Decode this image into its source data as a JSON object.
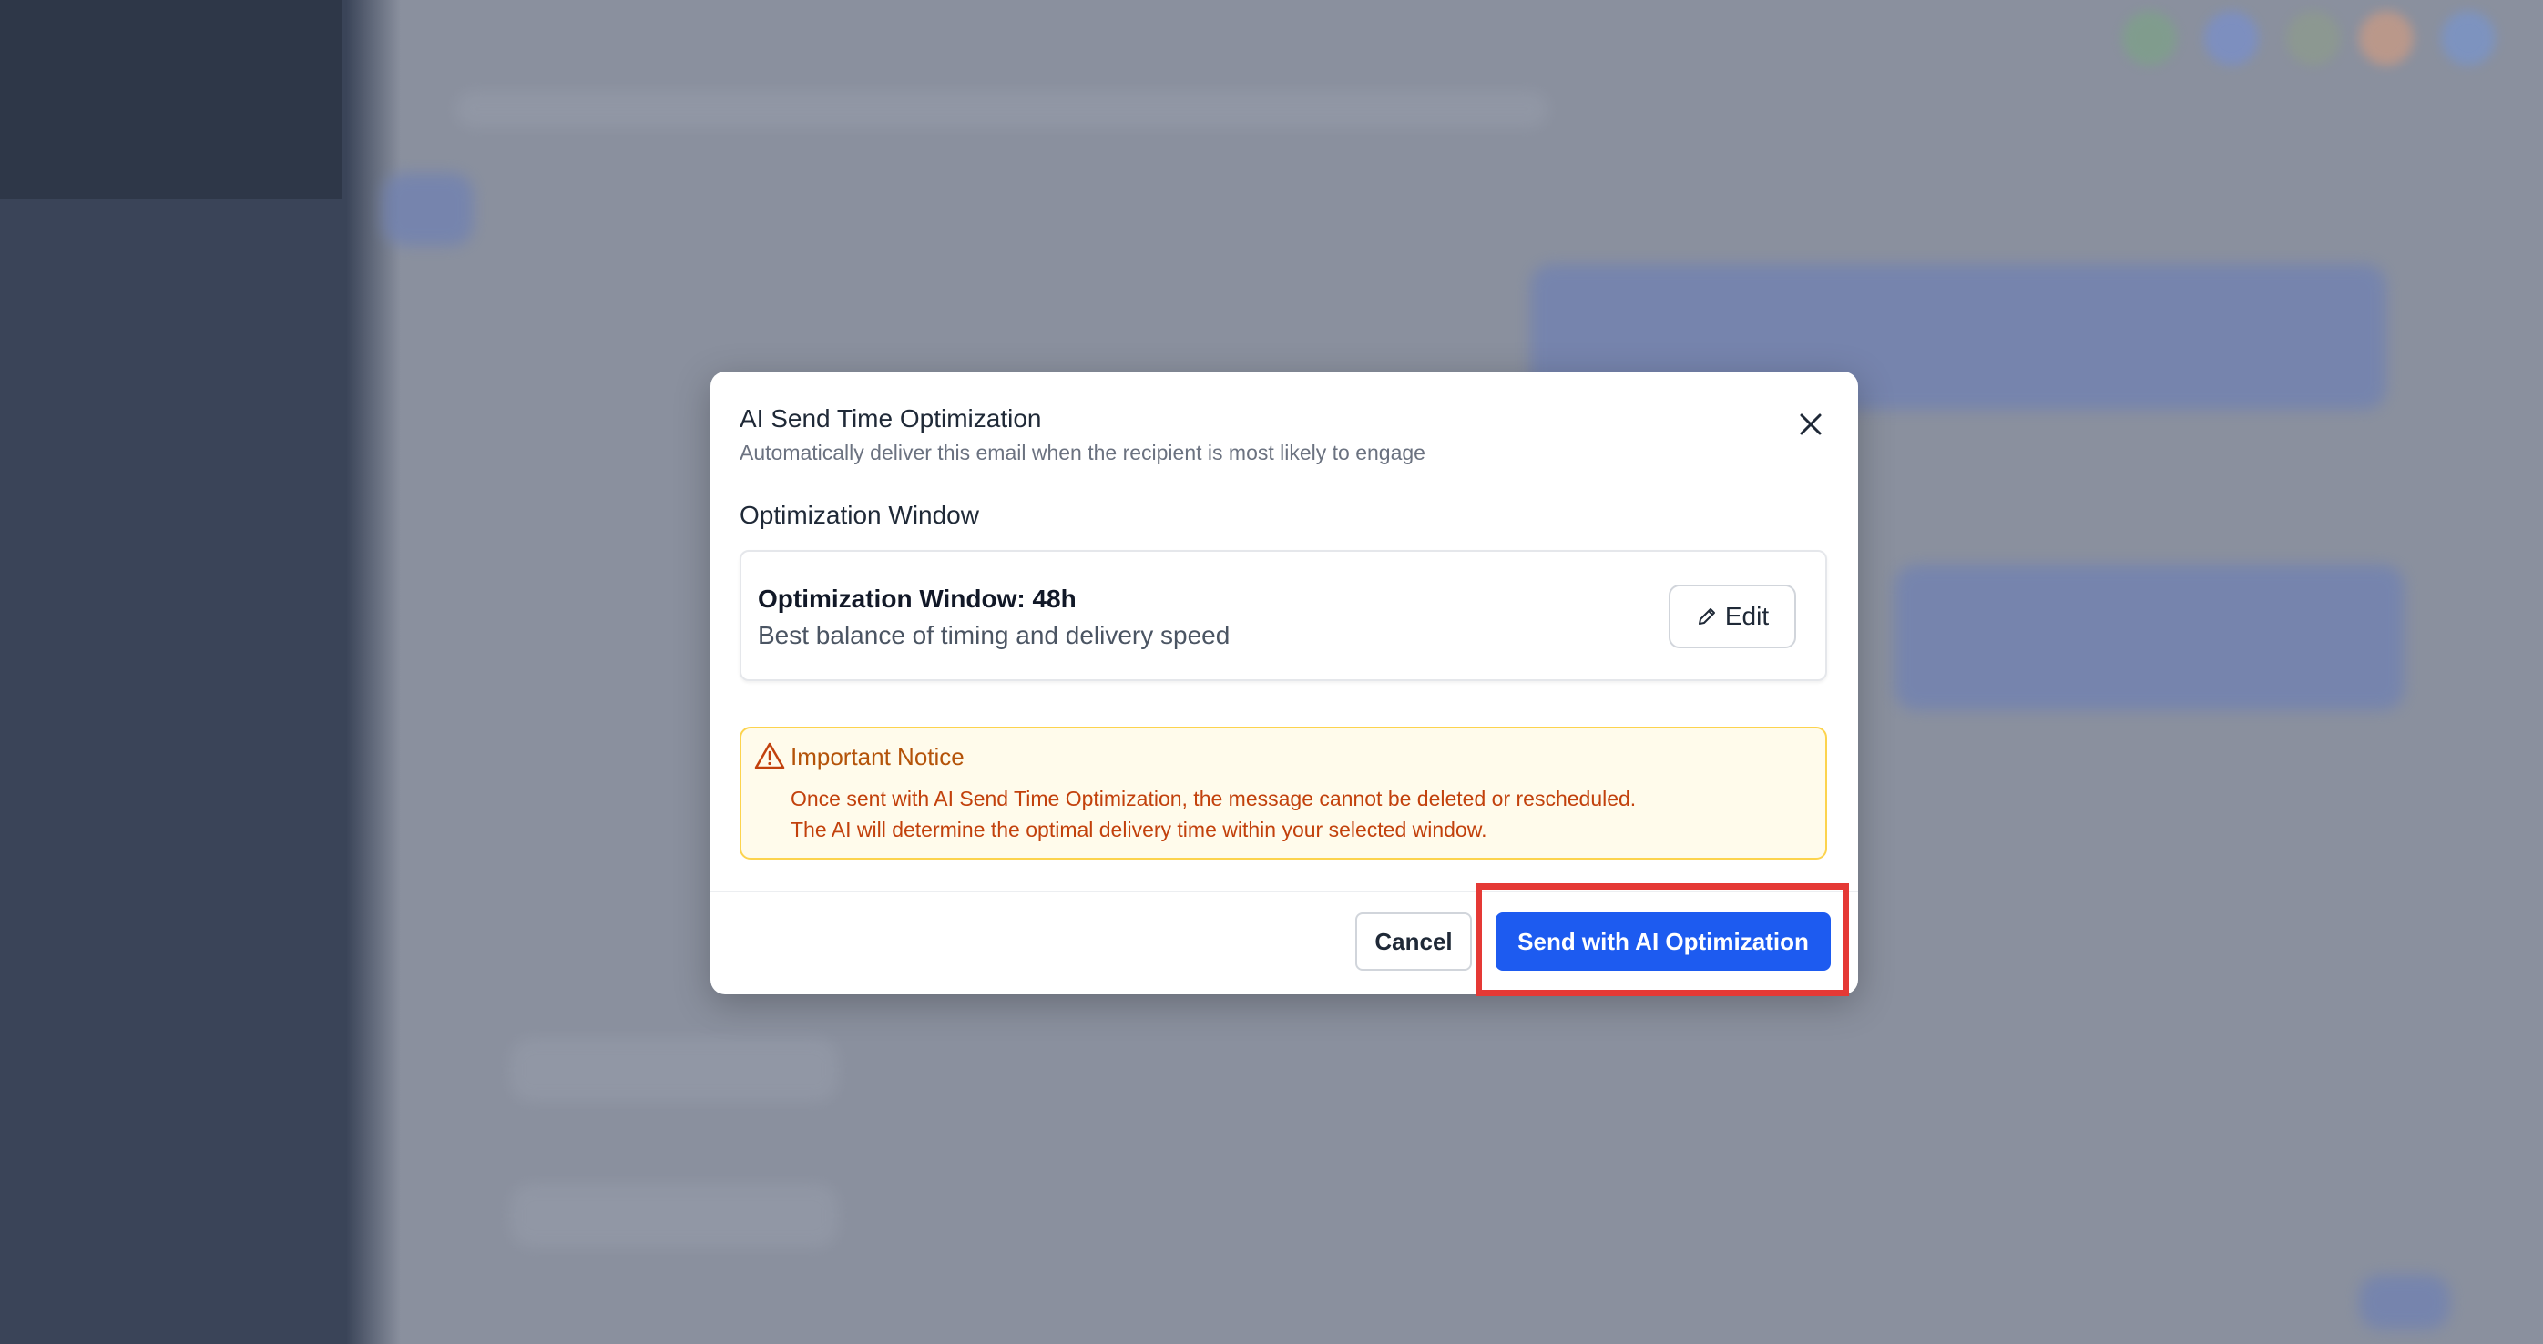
{
  "modal": {
    "title": "AI Send Time Optimization",
    "subtitle": "Automatically deliver this email when the recipient is most likely to engage",
    "close_icon": "close-icon",
    "section_label": "Optimization Window",
    "window_card": {
      "title": "Optimization Window: 48h",
      "description": "Best balance of timing and delivery speed",
      "edit_label": "Edit",
      "edit_icon": "pencil-icon"
    },
    "notice": {
      "icon": "warning-triangle-icon",
      "title": "Important Notice",
      "line1": "Once sent with AI Send Time Optimization, the message cannot be deleted or rescheduled.",
      "line2": "The AI will determine the optimal delivery time within your selected window."
    },
    "footer": {
      "cancel_label": "Cancel",
      "send_label": "Send with AI Optimization"
    }
  },
  "colors": {
    "primary": "#1d5bf0",
    "warning_text": "#c2410c",
    "warning_bg": "#fffbeb",
    "warning_border": "#fcd34d",
    "highlight": "#e53935",
    "overlay": "#8a909e"
  }
}
